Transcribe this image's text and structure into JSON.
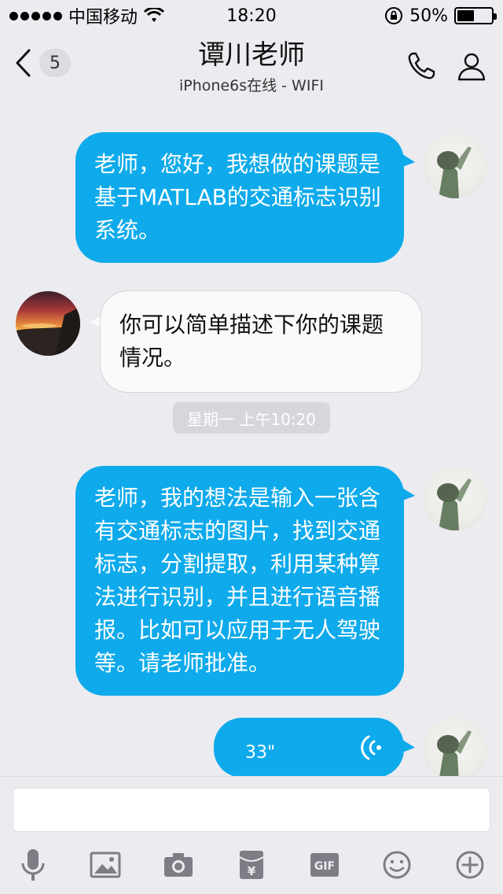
{
  "status_bar": {
    "carrier": "中国移动",
    "time": "18:20",
    "battery": "50%",
    "battery_level": 0.5
  },
  "nav": {
    "unread_count": "5",
    "title": "谭川老师",
    "subtitle": "iPhone6s在线 - WIFI"
  },
  "messages": [
    {
      "from": "self",
      "text": "老师，您好，我想做的课题是基于MATLAB的交通标志识别系统。"
    },
    {
      "from": "teacher",
      "text": "你可以简单描述下你的课题情况。"
    },
    {
      "from": "self",
      "text": "老师，我的想法是输入一张含有交通标志的图片，找到交通标志，分割提取，利用某种算法进行识别，并且进行语音播报。比如可以应用于无人驾驶等。请老师批准。"
    },
    {
      "from": "self",
      "type": "voice",
      "duration": "33\""
    }
  ],
  "timestamp": "星期一 上午10:20",
  "input": {
    "value": "",
    "placeholder": ""
  },
  "toolbar": {
    "icons": [
      "microphone-icon",
      "image-icon",
      "camera-icon",
      "red-packet-icon",
      "gif-icon",
      "emoji-icon",
      "plus-icon"
    ],
    "gif_label": "GIF"
  },
  "colors": {
    "outgoing_bubble": "#0eaaeb",
    "incoming_bubble": "#fafafa",
    "background": "#ebebf0",
    "icon_gray": "#7d7d85"
  }
}
